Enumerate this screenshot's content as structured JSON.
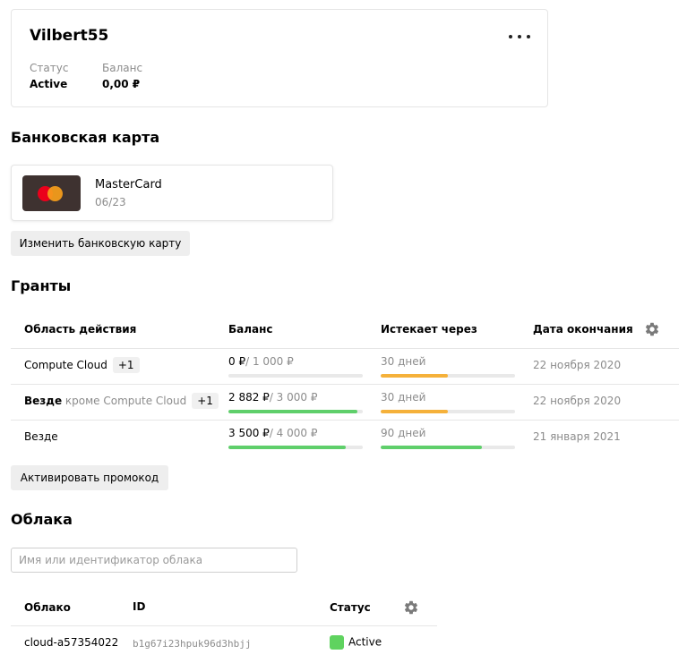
{
  "account": {
    "name": "Vilbert55",
    "status_label": "Статус",
    "status_value": "Active",
    "balance_label": "Баланс",
    "balance_value": "0,00 ₽"
  },
  "bank_card": {
    "section_title": "Банковская карта",
    "brand": "MasterCard",
    "expiry": "06/23",
    "change_button": "Изменить банковскую карту"
  },
  "grants": {
    "section_title": "Гранты",
    "columns": [
      "Область действия",
      "Баланс",
      "Истекает через",
      "Дата окончания"
    ],
    "rows": [
      {
        "scope_bold": "",
        "scope": "Compute Cloud",
        "extra": "+1",
        "balance_current": "0 ₽",
        "balance_total": "/ 1 000 ₽",
        "balance_fraction": 0.0,
        "expires": "30 дней",
        "expires_fraction": 0.5,
        "end_date": "22 ноября 2020"
      },
      {
        "scope_bold": "Везде",
        "scope": "кроме Compute Cloud",
        "extra": "+1",
        "balance_current": "2 882 ₽",
        "balance_total": "/ 3 000 ₽",
        "balance_fraction": 0.96,
        "expires": "30 дней",
        "expires_fraction": 0.5,
        "end_date": "22 ноября 2020"
      },
      {
        "scope_bold": "",
        "scope": "Везде",
        "extra": "",
        "balance_current": "3 500 ₽",
        "balance_total": "/ 4 000 ₽",
        "balance_fraction": 0.875,
        "expires": "90 дней",
        "expires_fraction": 0.75,
        "end_date": "21 января 2021"
      }
    ],
    "promo_button": "Активировать промокод"
  },
  "clouds": {
    "section_title": "Облака",
    "search_placeholder": "Имя или идентификатор облака",
    "columns": [
      "Облако",
      "ID",
      "Статус"
    ],
    "rows": [
      {
        "name": "cloud-a57354022",
        "id": "b1g67i23hpuk96d3hbjj",
        "status": "Active"
      }
    ]
  },
  "colors": {
    "progress_green": "#5fcf6b",
    "progress_orange": "#f5b13a",
    "status_green": "#5fd35f"
  },
  "icons": {
    "more": "more-horizontal-icon",
    "settings": "gear-icon",
    "card_brand": "mastercard-logo-icon"
  }
}
